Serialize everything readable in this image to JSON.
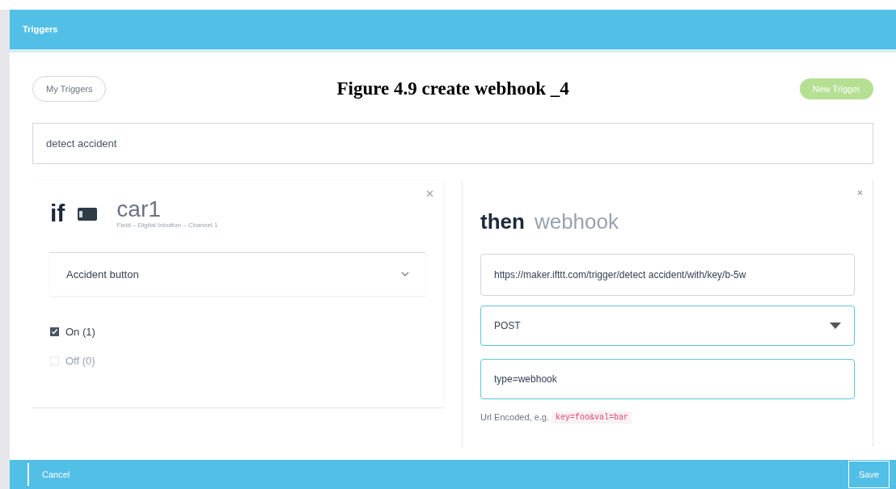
{
  "header": {
    "title": "Triggers"
  },
  "caption": "Figure 4.9 create webhook _4",
  "my_triggers_button": "My Triggers",
  "new_trigger_button": "New Trigger",
  "trigger_name": {
    "value": "detect accident"
  },
  "if_panel": {
    "keyword": "if",
    "device_name": "car1",
    "device_subtitle": "Field – Digital Inbutton – Channel 1",
    "field_select": {
      "value": "Accident button"
    },
    "options": [
      {
        "label": "On (1)",
        "checked": true
      },
      {
        "label": "Off (0)",
        "checked": false
      }
    ]
  },
  "then_panel": {
    "keyword": "then",
    "action_name": "webhook",
    "url_field": {
      "value": "https://maker.ifttt.com/trigger/detect accident/with/key/b-5w"
    },
    "method_select": {
      "value": "POST"
    },
    "body_field": {
      "value": "type=webhook"
    },
    "hint_text": "Url Encoded, e.g.",
    "hint_example": "key=foo&val=bar"
  },
  "footer": {
    "cancel": "Cancel",
    "save": "Save"
  }
}
